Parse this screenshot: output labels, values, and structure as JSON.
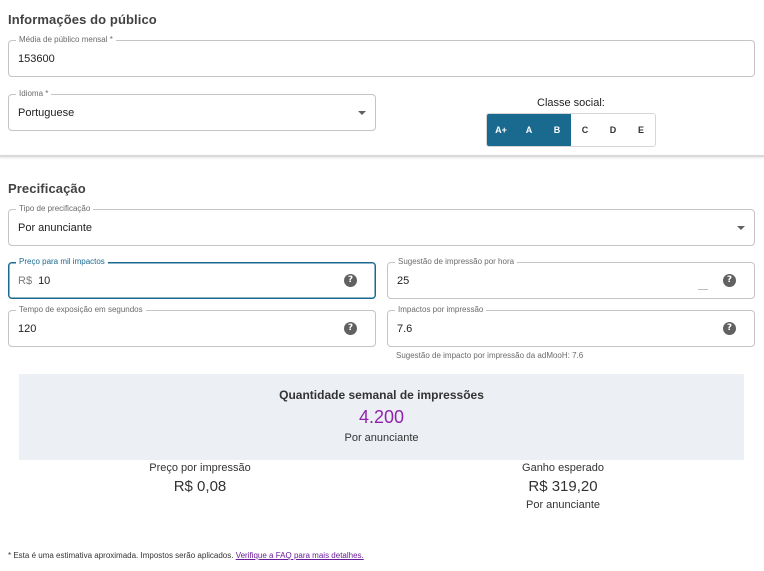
{
  "audience": {
    "title": "Informações do público",
    "monthly_audience": {
      "label": "Média de público mensal *",
      "value": "153600"
    },
    "language": {
      "label": "Idioma *",
      "value": "Portuguese"
    },
    "social_class": {
      "label": "Classe social:",
      "options": [
        {
          "label": "A+",
          "selected": true
        },
        {
          "label": "A",
          "selected": true
        },
        {
          "label": "B",
          "selected": true
        },
        {
          "label": "C",
          "selected": false
        },
        {
          "label": "D",
          "selected": false
        },
        {
          "label": "E",
          "selected": false
        }
      ]
    }
  },
  "pricing": {
    "title": "Precificação",
    "pricing_type": {
      "label": "Tipo de precificação",
      "value": "Por anunciante"
    },
    "cpm": {
      "label": "Preço para mil impactos",
      "prefix": "R$",
      "value": "10"
    },
    "hourly_impressions": {
      "label": "Sugestão de impressão por hora",
      "value": "25"
    },
    "exposure_time": {
      "label": "Tempo de exposição em segundos",
      "value": "120"
    },
    "impacts_per_impression": {
      "label": "Impactos por impressão",
      "value": "7.6",
      "hint": "Sugestão de impacto por impressão da adMooH: 7.6"
    },
    "help_icon": "help-circle-icon"
  },
  "summary": {
    "title": "Quantidade semanal de impressões",
    "value": "4.200",
    "subtitle": "Por anunciante",
    "value_color": "#8e24aa"
  },
  "stats": {
    "price_per_impression": {
      "label": "Preço por impressão",
      "value": "R$ 0,08"
    },
    "expected_gain": {
      "label": "Ganho esperado",
      "value": "R$ 319,20",
      "subtitle": "Por anunciante"
    }
  },
  "footnote": {
    "text": "* Esta é uma estimativa aproximada. Impostos serão aplicados.",
    "link": "Verifique a FAQ para mais detalhes."
  },
  "colors": {
    "accent": "#1a6a8f",
    "highlight": "#8e24aa",
    "summary_bg": "#eceff4"
  }
}
